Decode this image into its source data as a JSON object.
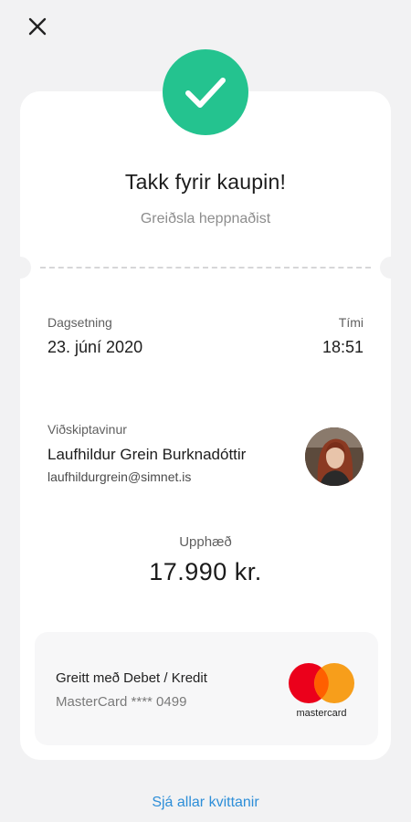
{
  "title": "Takk fyrir kaupin!",
  "subtitle": "Greiðsla heppnaðist",
  "icons": {
    "close": "close-icon",
    "success": "checkmark-icon",
    "card_brand": "mastercard-logo"
  },
  "colors": {
    "success": "#24c38f",
    "link": "#2d8ed8",
    "background": "#f2f2f3",
    "card": "#ffffff"
  },
  "date": {
    "label": "Dagsetning",
    "value": "23. júní 2020"
  },
  "time": {
    "label": "Tími",
    "value": "18:51"
  },
  "customer": {
    "label": "Viðskiptavinur",
    "name": "Laufhildur Grein Burknadóttir",
    "email": "laufhildurgrein@simnet.is"
  },
  "amount": {
    "label": "Upphæð",
    "value": "17.990 kr."
  },
  "payment": {
    "method": "Greitt með Debet / Kredit",
    "card": "MasterCard **** 0499",
    "brand_text": "mastercard"
  },
  "link": {
    "all_receipts": "Sjá allar kvittanir"
  }
}
